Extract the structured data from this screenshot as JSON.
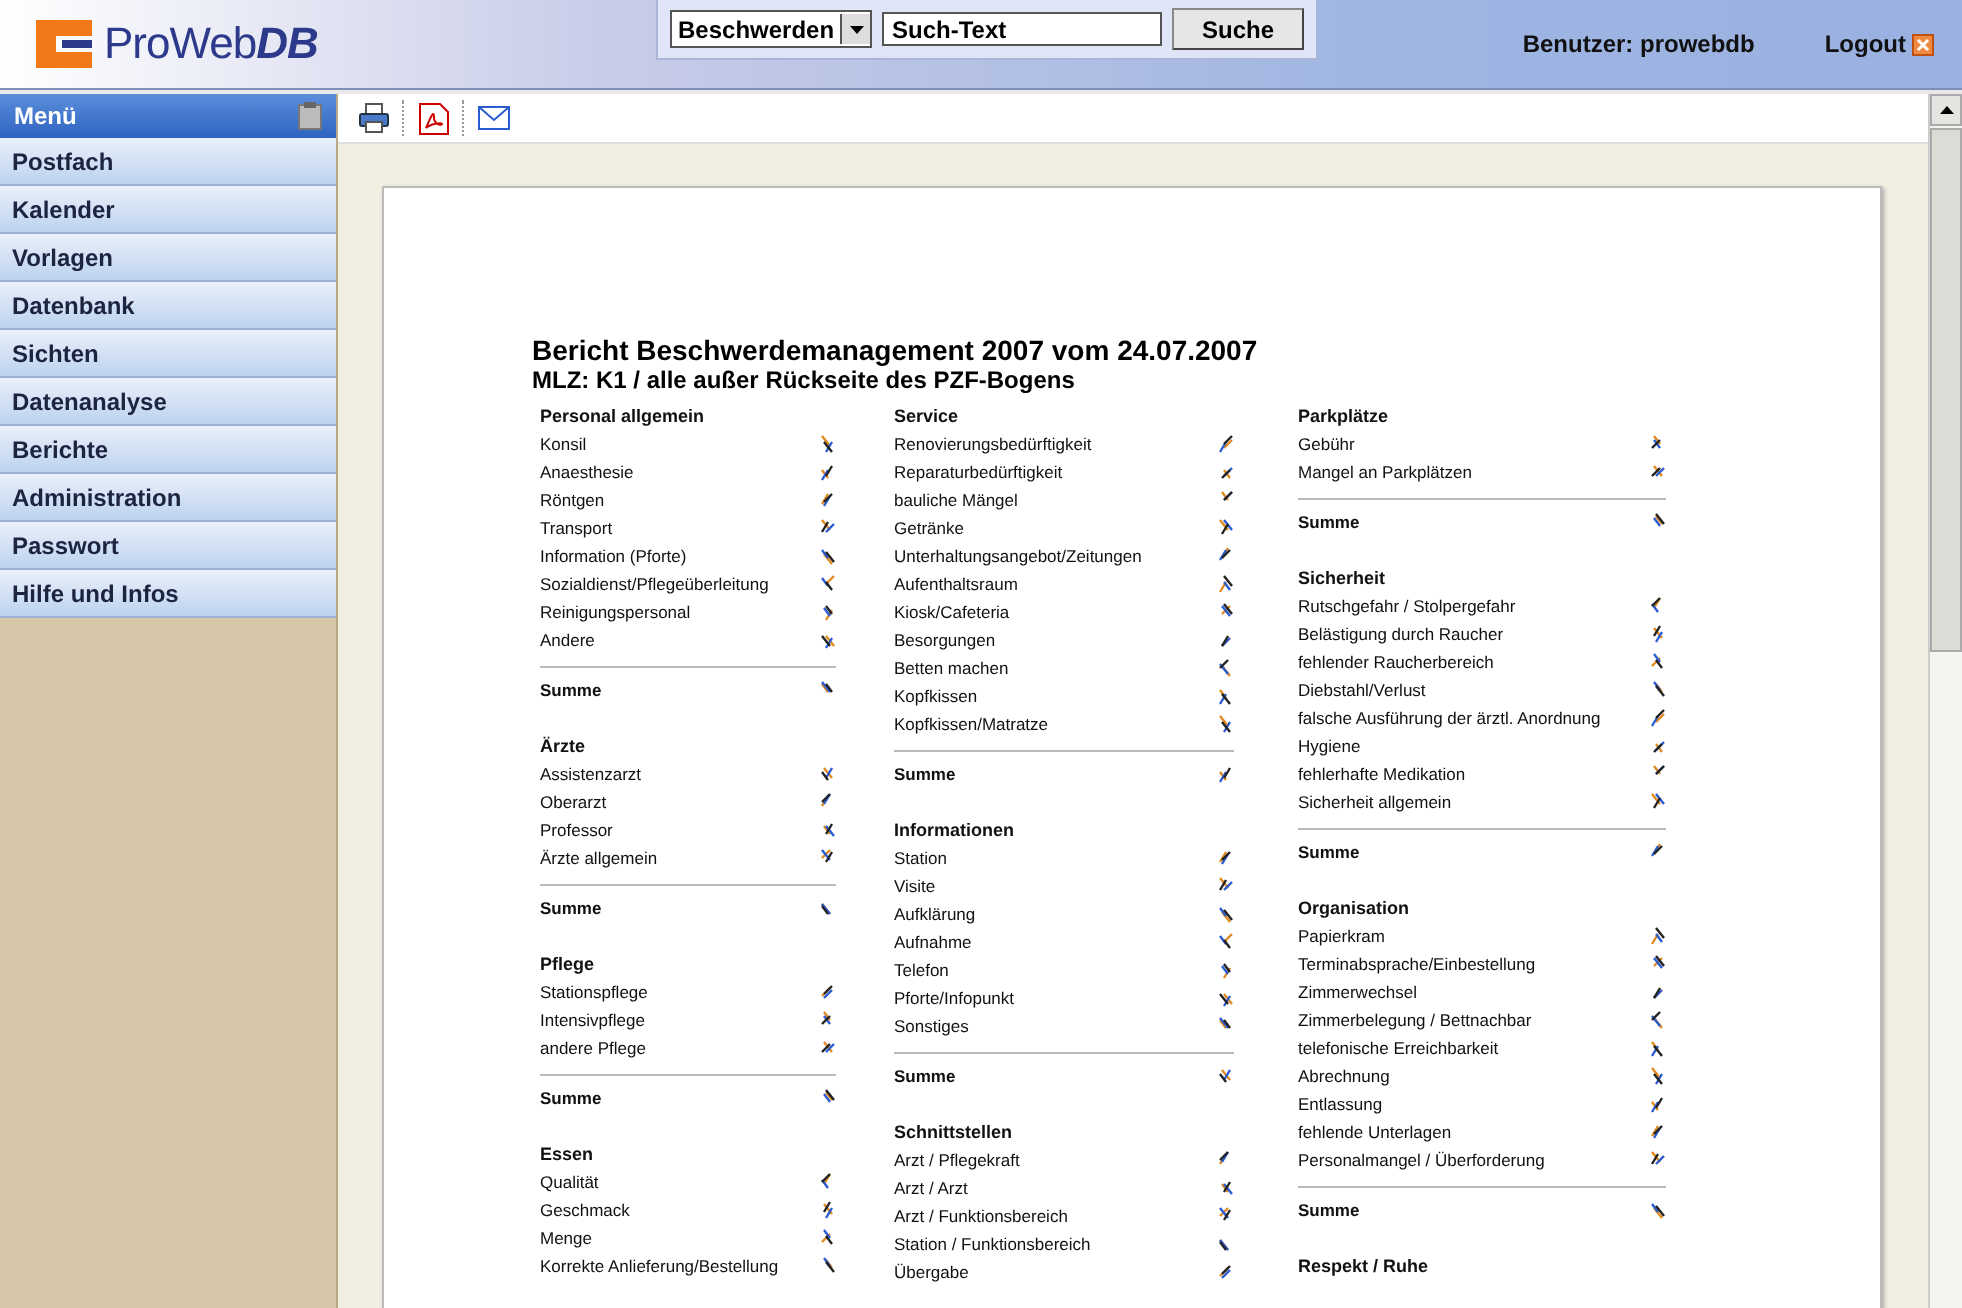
{
  "header": {
    "logo_text": "ProWeb",
    "logo_accent": "DB",
    "search": {
      "category": "Beschwerden",
      "value": "Such-Text",
      "button": "Suche"
    },
    "user": "Benutzer: prowebdb",
    "logout": "Logout"
  },
  "sidebar": {
    "title": "Menü",
    "items": [
      {
        "label": "Postfach"
      },
      {
        "label": "Kalender"
      },
      {
        "label": "Vorlagen"
      },
      {
        "label": "Datenbank"
      },
      {
        "label": "Sichten"
      },
      {
        "label": "Datenanalyse"
      },
      {
        "label": "Berichte"
      },
      {
        "label": "Administration"
      },
      {
        "label": "Passwort"
      },
      {
        "label": "Hilfe und Infos"
      }
    ]
  },
  "report": {
    "title": "Bericht Beschwerdemanagement 2007 vom 24.07.2007",
    "subtitle": "MLZ: K1 / alle außer Rückseite des PZF-Bogens",
    "columns": [
      {
        "sections": [
          {
            "heading": "Personal allgemein",
            "items": [
              "Konsil",
              "Anaesthesie",
              "Röntgen",
              "Transport",
              "Information (Pforte)",
              "Sozialdienst/Pflegeüberleitung",
              "Reinigungspersonal",
              "Andere"
            ],
            "summary": "Summe"
          },
          {
            "heading": "Ärzte",
            "items": [
              "Assistenzarzt",
              "Oberarzt",
              "Professor",
              "Ärzte allgemein"
            ],
            "summary": "Summe"
          },
          {
            "heading": "Pflege",
            "items": [
              "Stationspflege",
              "Intensivpflege",
              "andere Pflege"
            ],
            "summary": "Summe"
          },
          {
            "heading": "Essen",
            "items": [
              "Qualität",
              "Geschmack",
              "Menge",
              "Korrekte Anlieferung/Bestellung"
            ]
          }
        ]
      },
      {
        "sections": [
          {
            "heading": "Service",
            "items": [
              "Renovierungsbedürftigkeit",
              "Reparaturbedürftigkeit",
              "bauliche Mängel",
              "Getränke",
              "Unterhaltungsangebot/Zeitungen",
              "Aufenthaltsraum",
              "Kiosk/Cafeteria",
              "Besorgungen",
              "Betten machen",
              "Kopfkissen",
              "Kopfkissen/Matratze"
            ],
            "summary": "Summe"
          },
          {
            "heading": "Informationen",
            "items": [
              "Station",
              "Visite",
              "Aufklärung",
              "Aufnahme",
              "Telefon",
              "Pforte/Infopunkt",
              "Sonstiges"
            ],
            "summary": "Summe"
          },
          {
            "heading": "Schnittstellen",
            "items": [
              "Arzt / Pflegekraft",
              "Arzt / Arzt",
              "Arzt / Funktionsbereich",
              "Station / Funktionsbereich",
              "Übergabe"
            ]
          }
        ]
      },
      {
        "sections": [
          {
            "heading": "Parkplätze",
            "items": [
              "Gebühr",
              "Mangel an Parkplätzen"
            ],
            "summary": "Summe"
          },
          {
            "heading": "Sicherheit",
            "items": [
              "Rutschgefahr / Stolpergefahr",
              "Belästigung durch Raucher",
              "fehlender Raucherbereich",
              "Diebstahl/Verlust",
              "falsche Ausführung der ärztl. Anordnung",
              "Hygiene",
              "fehlerhafte Medikation",
              "Sicherheit allgemein"
            ],
            "summary": "Summe"
          },
          {
            "heading": "Organisation",
            "items": [
              "Papierkram",
              "Terminabsprache/Einbestellung",
              "Zimmerwechsel",
              "Zimmerbelegung / Bettnachbar",
              "telefonische Erreichbarkeit",
              "Abrechnung",
              "Entlassung",
              "fehlende Unterlagen",
              "Personalmangel / Überforderung"
            ],
            "summary": "Summe"
          },
          {
            "heading": "Respekt / Ruhe"
          }
        ]
      }
    ]
  }
}
